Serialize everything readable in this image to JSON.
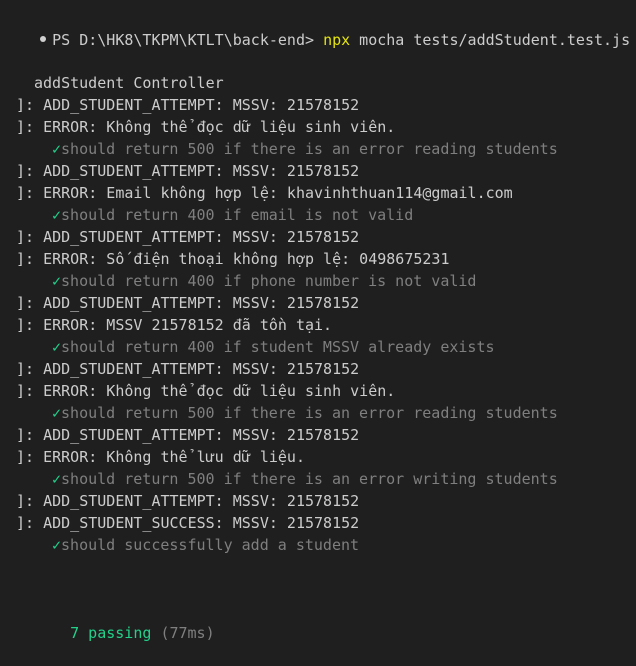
{
  "theme": {
    "background": "#1f1f1f",
    "foreground": "#cccccc",
    "accent_yellow": "#e5e510",
    "success_green": "#23d18b",
    "muted_gray": "#7f7f7f"
  },
  "prompt": {
    "text": "PS D:\\HK8\\TKPM\\KTLT\\back-end> ",
    "npx": "npx",
    "rest": " mocha tests/addStudent.test.js"
  },
  "suite_title": "addStudent Controller",
  "lines": [
    {
      "kind": "log",
      "text": "]: ADD_STUDENT_ATTEMPT: MSSV: 21578152"
    },
    {
      "kind": "log",
      "text": "]: ERROR: Không thể đọc dữ liệu sinh viên."
    },
    {
      "kind": "test",
      "check": "✓",
      "text": "should return 500 if there is an error reading students"
    },
    {
      "kind": "log",
      "text": "]: ADD_STUDENT_ATTEMPT: MSSV: 21578152"
    },
    {
      "kind": "log",
      "text": "]: ERROR: Email không hợp lệ: khavinhthuan114@gmail.com"
    },
    {
      "kind": "test",
      "check": "✓",
      "text": "should return 400 if email is not valid"
    },
    {
      "kind": "log",
      "text": "]: ADD_STUDENT_ATTEMPT: MSSV: 21578152"
    },
    {
      "kind": "log",
      "text": "]: ERROR: Số điện thoại không hợp lệ: 0498675231"
    },
    {
      "kind": "test",
      "check": "✓",
      "text": "should return 400 if phone number is not valid"
    },
    {
      "kind": "log",
      "text": "]: ADD_STUDENT_ATTEMPT: MSSV: 21578152"
    },
    {
      "kind": "log",
      "text": "]: ERROR: MSSV 21578152 đã tồn tại."
    },
    {
      "kind": "test",
      "check": "✓",
      "text": "should return 400 if student MSSV already exists"
    },
    {
      "kind": "log",
      "text": "]: ADD_STUDENT_ATTEMPT: MSSV: 21578152"
    },
    {
      "kind": "log",
      "text": "]: ERROR: Không thể đọc dữ liệu sinh viên."
    },
    {
      "kind": "test",
      "check": "✓",
      "text": "should return 500 if there is an error reading students"
    },
    {
      "kind": "log",
      "text": "]: ADD_STUDENT_ATTEMPT: MSSV: 21578152"
    },
    {
      "kind": "log",
      "text": "]: ERROR: Không thể lưu dữ liệu."
    },
    {
      "kind": "test",
      "check": "✓",
      "text": "should return 500 if there is an error writing students"
    },
    {
      "kind": "log",
      "text": "]: ADD_STUDENT_ATTEMPT: MSSV: 21578152"
    },
    {
      "kind": "log",
      "text": "]: ADD_STUDENT_SUCCESS: MSSV: 21578152"
    },
    {
      "kind": "test",
      "check": "✓",
      "text": "should successfully add a student"
    }
  ],
  "summary": {
    "passing": "7 passing",
    "duration": "(77ms)"
  }
}
